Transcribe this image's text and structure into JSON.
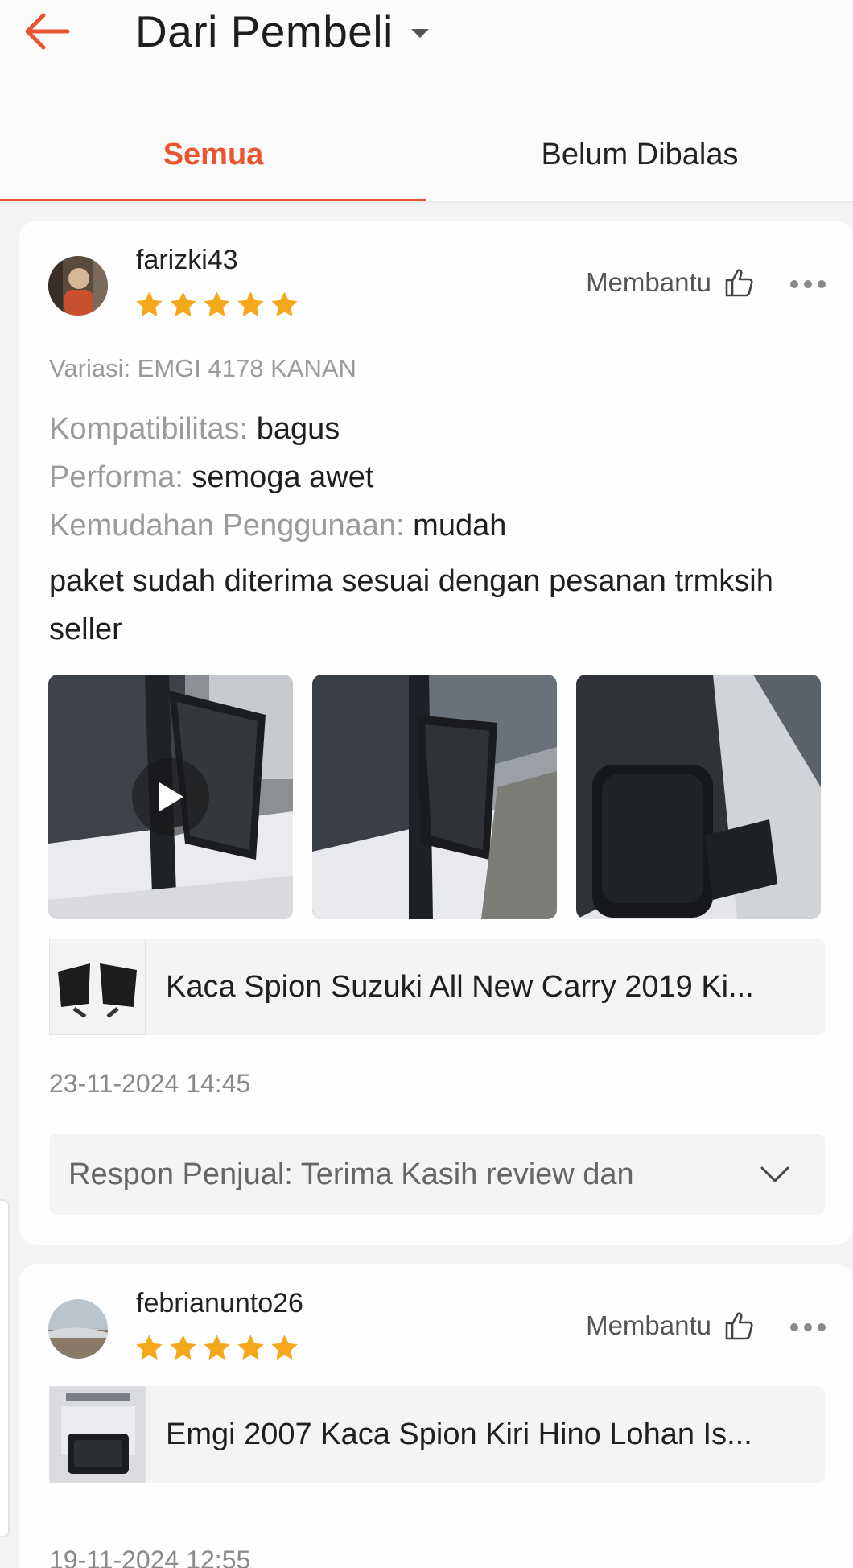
{
  "header": {
    "back_icon": "arrow-left-icon",
    "title": "Dari Pembeli",
    "accent_color": "#e8552f"
  },
  "tabs": [
    {
      "label": "Semua",
      "active": true
    },
    {
      "label": "Belum Dibalas",
      "active": false
    }
  ],
  "reviews": [
    {
      "username": "farizki43",
      "rating": 5,
      "helpful_label": "Membantu",
      "variation": "Variasi: EMGI 4178 KANAN",
      "attributes": [
        {
          "key": "Kompatibilitas:",
          "value": "bagus"
        },
        {
          "key": "Performa:",
          "value": "semoga awet"
        },
        {
          "key": "Kemudahan Penggunaan:",
          "value": "mudah"
        }
      ],
      "comment": "paket sudah diterima sesuai dengan pesanan trmksih seller",
      "media": [
        "video",
        "photo",
        "photo"
      ],
      "product_name": "Kaca Spion Suzuki All New Carry 2019 Ki...",
      "date": "23-11-2024 14:45",
      "seller_response": "Respon Penjual: Terima Kasih review dan"
    },
    {
      "username": "febrianunto26",
      "rating": 5,
      "helpful_label": "Membantu",
      "product_name": "Emgi 2007 Kaca Spion Kiri Hino Lohan Is...",
      "date": "19-11-2024 12:55"
    }
  ]
}
